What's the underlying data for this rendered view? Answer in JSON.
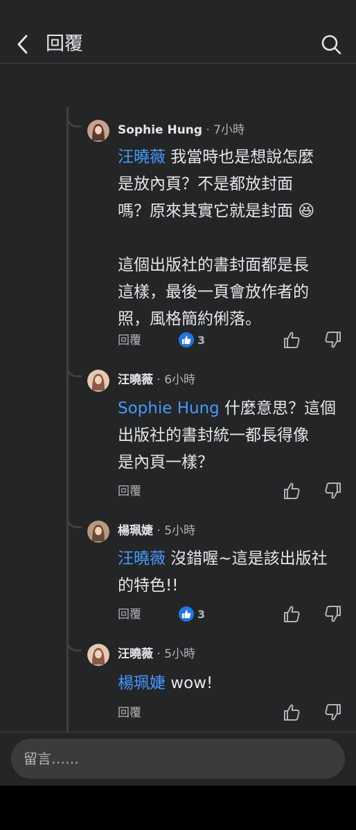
{
  "header": {
    "title": "回覆"
  },
  "comments": [
    {
      "author": "Sophie Hung",
      "time": " · 7小時",
      "body": [
        [
          {
            "t": "汪曉薇",
            "m": true
          },
          {
            "t": " 我當時也是想說怎麼"
          }
        ],
        [
          {
            "t": "是放內頁？不是都放封面"
          }
        ],
        [
          {
            "t": "嗎？原來其實它就是封面 😆"
          }
        ],
        [
          {
            "t": " "
          }
        ],
        [
          {
            "t": "這個出版社的書封面都是長"
          }
        ],
        [
          {
            "t": "這樣，最後一頁會放作者的"
          }
        ],
        [
          {
            "t": "照，風格簡約俐落。"
          }
        ]
      ],
      "reply_label": "回覆",
      "reaction_count": "3"
    },
    {
      "author": "汪曉薇",
      "time": " · 6小時",
      "body": [
        [
          {
            "t": "Sophie Hung",
            "m": true
          },
          {
            "t": " 什麼意思？這個"
          }
        ],
        [
          {
            "t": "出版社的書封統一都長得像"
          }
        ],
        [
          {
            "t": "是內頁一樣？"
          }
        ]
      ],
      "reply_label": "回覆",
      "reaction_count": ""
    },
    {
      "author": "楊珮婕",
      "time": " · 5小時",
      "body": [
        [
          {
            "t": "汪曉薇",
            "m": true
          },
          {
            "t": " 沒錯喔~這是該出版社"
          }
        ],
        [
          {
            "t": "的特色!!"
          }
        ]
      ],
      "reply_label": "回覆",
      "reaction_count": "3"
    },
    {
      "author": "汪曉薇",
      "time": " · 5小時",
      "body": [
        [
          {
            "t": "楊珮婕",
            "m": true
          },
          {
            "t": " wow!"
          }
        ]
      ],
      "reply_label": "回覆",
      "reaction_count": ""
    }
  ],
  "composer": {
    "placeholder": "留言……"
  },
  "colors": {
    "background": "#242526",
    "mention": "#4599ff",
    "like_badge": "#2374e1",
    "composer": "#3a3b3c"
  }
}
